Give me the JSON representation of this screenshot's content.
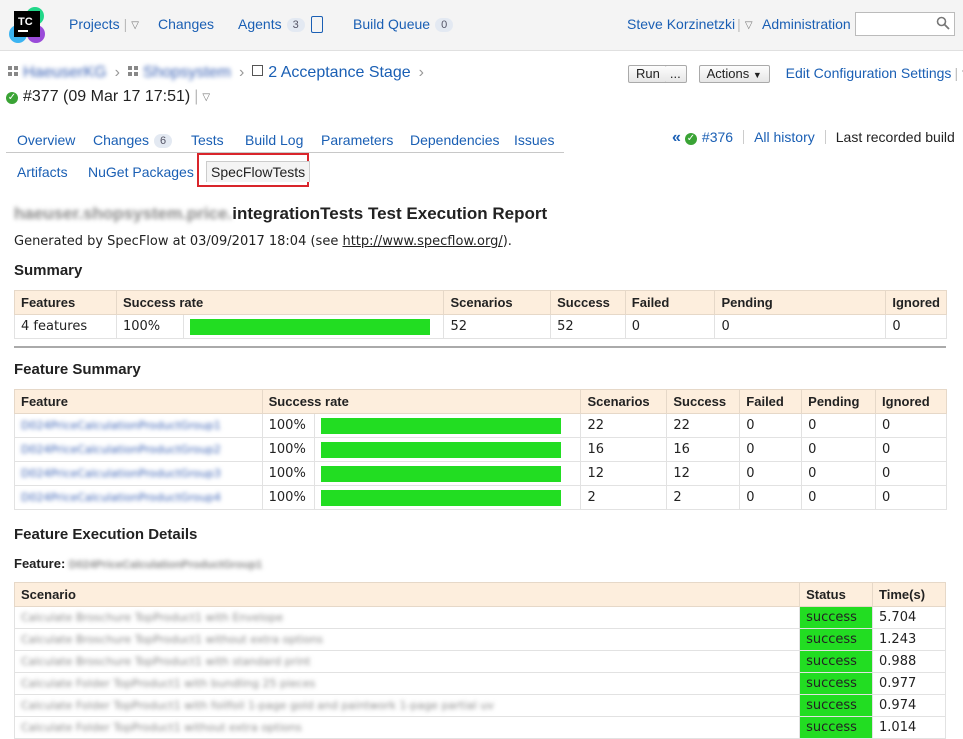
{
  "app": {
    "logo_text": "TC"
  },
  "topnav": {
    "projects": "Projects",
    "changes": "Changes",
    "agents": "Agents",
    "agents_count": "3",
    "build_queue": "Build Queue",
    "build_queue_count": "0",
    "user": "Steve Korzinetzki",
    "administration": "Administration",
    "search_placeholder": ""
  },
  "breadcrumb": {
    "project": "HaeuserKG",
    "subproject": "Shopsystem",
    "configuration": "2 Acceptance Stage"
  },
  "build": {
    "status": "success",
    "title": "#377 (09 Mar 17 17:51)"
  },
  "tools": {
    "run": "Run",
    "run_more": "...",
    "actions": "Actions",
    "edit_configuration": "Edit Configuration Settings"
  },
  "tabs_row1": [
    {
      "label": "Overview"
    },
    {
      "label": "Changes",
      "badge": "6"
    },
    {
      "label": "Tests"
    },
    {
      "label": "Build Log"
    },
    {
      "label": "Parameters"
    },
    {
      "label": "Dependencies"
    },
    {
      "label": "Issues"
    }
  ],
  "tabs_row2": [
    {
      "label": "Artifacts"
    },
    {
      "label": "NuGet Packages"
    },
    {
      "label": "SpecFlowTests",
      "active": true
    }
  ],
  "history": {
    "prev_build": "#376",
    "all_history": "All history",
    "last_recorded": "Last recorded build"
  },
  "report": {
    "title_prefix": "haeuser.shopsystem.price.",
    "title": "integrationTests Test Execution Report",
    "generated_prefix": "Generated by SpecFlow at 03/09/2017 18:04 (see ",
    "generated_link": "http://www.specflow.org/",
    "generated_suffix": ")."
  },
  "summary": {
    "heading": "Summary",
    "headers": [
      "Features",
      "Success rate",
      "Scenarios",
      "Success",
      "Failed",
      "Pending",
      "Ignored"
    ],
    "row": {
      "features": "4 features",
      "success_rate": "100%",
      "success_fraction": 1.0,
      "scenarios": "52",
      "success": "52",
      "failed": "0",
      "pending": "0",
      "ignored": "0"
    }
  },
  "feature_summary": {
    "heading": "Feature Summary",
    "headers": [
      "Feature",
      "Success rate",
      "Scenarios",
      "Success",
      "Failed",
      "Pending",
      "Ignored"
    ],
    "rows": [
      {
        "feature": "D024PriceCalculationProductGroup1",
        "rate": "100%",
        "success_fraction": 1.0,
        "scenarios": "22",
        "success": "22",
        "failed": "0",
        "pending": "0",
        "ignored": "0"
      },
      {
        "feature": "D024PriceCalculationProductGroup2",
        "rate": "100%",
        "success_fraction": 1.0,
        "scenarios": "16",
        "success": "16",
        "failed": "0",
        "pending": "0",
        "ignored": "0"
      },
      {
        "feature": "D024PriceCalculationProductGroup3",
        "rate": "100%",
        "success_fraction": 1.0,
        "scenarios": "12",
        "success": "12",
        "failed": "0",
        "pending": "0",
        "ignored": "0"
      },
      {
        "feature": "D024PriceCalculationProductGroup4",
        "rate": "100%",
        "success_fraction": 1.0,
        "scenarios": "2",
        "success": "2",
        "failed": "0",
        "pending": "0",
        "ignored": "0"
      }
    ]
  },
  "execution_details": {
    "heading": "Feature Execution Details",
    "feature_label": "Feature:",
    "feature_name": "D024PriceCalculationProductGroup1",
    "headers": [
      "Scenario",
      "Status",
      "Time(s)"
    ],
    "rows": [
      {
        "scenario": "Calculate Broschure TopProduct1 with Envelope",
        "status": "success",
        "time": "5.704"
      },
      {
        "scenario": "Calculate Broschure TopProduct1 without extra options",
        "status": "success",
        "time": "1.243"
      },
      {
        "scenario": "Calculate Broschure TopProduct1 with standard print",
        "status": "success",
        "time": "0.988"
      },
      {
        "scenario": "Calculate Folder TopProduct1 with bundling 25 pieces",
        "status": "success",
        "time": "0.977"
      },
      {
        "scenario": "Calculate Folder TopProduct1 with foilfoil 1-page gold and paintwork 1-page partial uv",
        "status": "success",
        "time": "0.974"
      },
      {
        "scenario": "Calculate Folder TopProduct1 without extra options",
        "status": "success",
        "time": "1.014"
      }
    ]
  },
  "colors": {
    "success_green": "#22dd22",
    "header_bg": "#fdeedd",
    "link": "#1a5fb4",
    "highlight_red": "#d9252b"
  }
}
